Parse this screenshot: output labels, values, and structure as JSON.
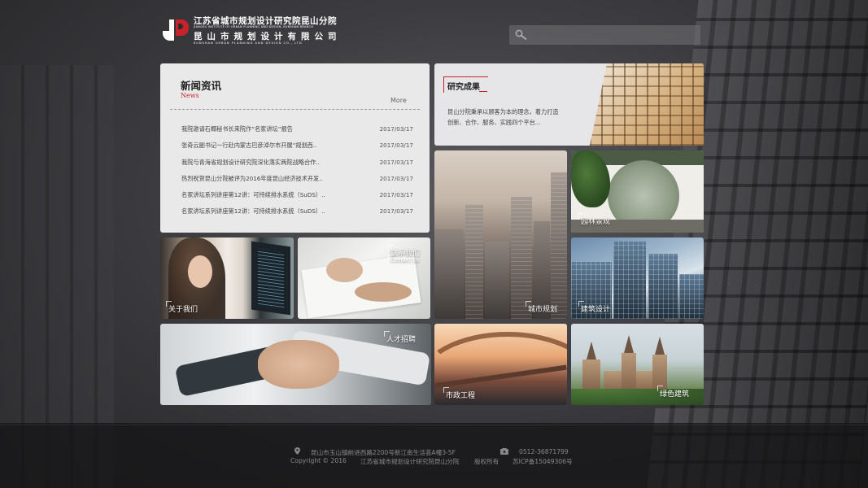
{
  "header": {
    "logo": {
      "cn_line1": "江苏省城市规划设计研究院昆山分院",
      "en_line1": "JIANGSU INSTITUTE OF URBAN PLANNING AND DESIGN, KUNSHAN BRANCH",
      "cn_line2": "昆山市规划设计有限公司",
      "en_line2": "KUNSHAN URBAN PLANNING AND DESIGN CO., LTD"
    },
    "search": {
      "value": "",
      "placeholder": "",
      "icon": "search-icon"
    }
  },
  "news": {
    "title": "新闻资讯",
    "subtitle": "News",
    "more_label": "More",
    "items": [
      {
        "title": "我院邀请石椰秘书长来院作“名家讲坛”报告",
        "date": "2017/03/17"
      },
      {
        "title": "张奇云副书记一行赴内蒙古巴彦淖尔市开展“规划西..",
        "date": "2017/03/17"
      },
      {
        "title": "我院与青海省规划设计研究院深化落实两院战略合作..",
        "date": "2017/03/17"
      },
      {
        "title": "热烈祝贺昆山分院被评为2016年度昆山经济技术开发..",
        "date": "2017/03/17"
      },
      {
        "title": "名家讲坛系列讲座第12讲：可持续排水系统（SuDS）..",
        "date": "2017/03/17"
      },
      {
        "title": "名家讲坛系列讲座第12讲：可持续排水系统（SuDS）..",
        "date": "2017/03/17"
      }
    ]
  },
  "research": {
    "title": "研究成果",
    "description": "昆山分院秉承以顾客为本的理念，着力打造创新、合作、服务、实践四个平台..."
  },
  "tiles": {
    "about": "关于我们",
    "contact": "联系我们",
    "contact_en": "Contact  Us",
    "city_planning": "城市规划",
    "garden": "园林景观",
    "architecture": "建筑设计",
    "talent": "人才招聘",
    "municipal": "市政工程",
    "green_building": "绿色建筑"
  },
  "footer": {
    "address": "昆山市玉山镇前进西路2200号新江南生活荟A幢3-5F",
    "phone": "0512-36871799",
    "copyright": "Copyright © 2016",
    "institute": "江苏省城市规划设计研究院昆山分院",
    "rights": "版权所有",
    "icp": "苏ICP备15049306号"
  },
  "colors": {
    "accent_red": "#c8222b",
    "panel_bg": "#e9e9ea",
    "page_bg": "#2b2b2d"
  }
}
